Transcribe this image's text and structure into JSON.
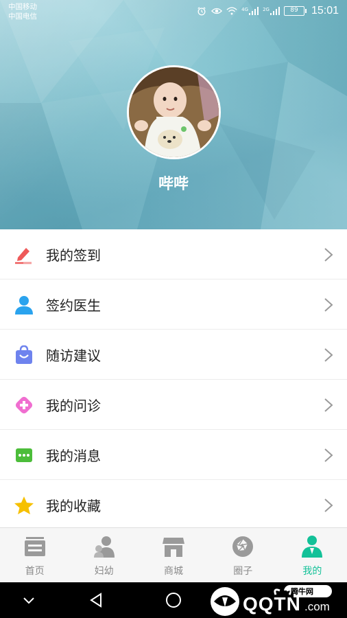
{
  "status_bar": {
    "carrier_1": "中国移动",
    "carrier_2": "中国电信",
    "signal_1_label": "4G",
    "signal_2_label": "2G",
    "battery": "89",
    "time": "15:01"
  },
  "profile": {
    "username": "哔哔"
  },
  "menu": {
    "items": [
      {
        "label": "我的签到",
        "icon": "pen-edit-icon",
        "color": "#ee5a5a"
      },
      {
        "label": "签约医生",
        "icon": "person-icon",
        "color": "#2aa3ee"
      },
      {
        "label": "随访建议",
        "icon": "bag-smile-icon",
        "color": "#6e83ee"
      },
      {
        "label": "我的问诊",
        "icon": "medical-cross-icon",
        "color": "#f06ed0"
      },
      {
        "label": "我的消息",
        "icon": "chat-dots-icon",
        "color": "#4cbd3a"
      },
      {
        "label": "我的收藏",
        "icon": "star-icon",
        "color": "#f6c000"
      }
    ]
  },
  "tabbar": {
    "tabs": [
      {
        "label": "首页",
        "icon": "home-icon",
        "active": false
      },
      {
        "label": "妇幼",
        "icon": "mother-child-icon",
        "active": false
      },
      {
        "label": "商城",
        "icon": "shop-icon",
        "active": false
      },
      {
        "label": "圈子",
        "icon": "circle-aperture-icon",
        "active": false
      },
      {
        "label": "我的",
        "icon": "profile-icon",
        "active": true
      }
    ],
    "active_color": "#13c198",
    "inactive_color": "#8a8a8a"
  },
  "watermark": {
    "brand": "QQTN",
    "suffix": ".com",
    "badge": "腾牛网"
  }
}
